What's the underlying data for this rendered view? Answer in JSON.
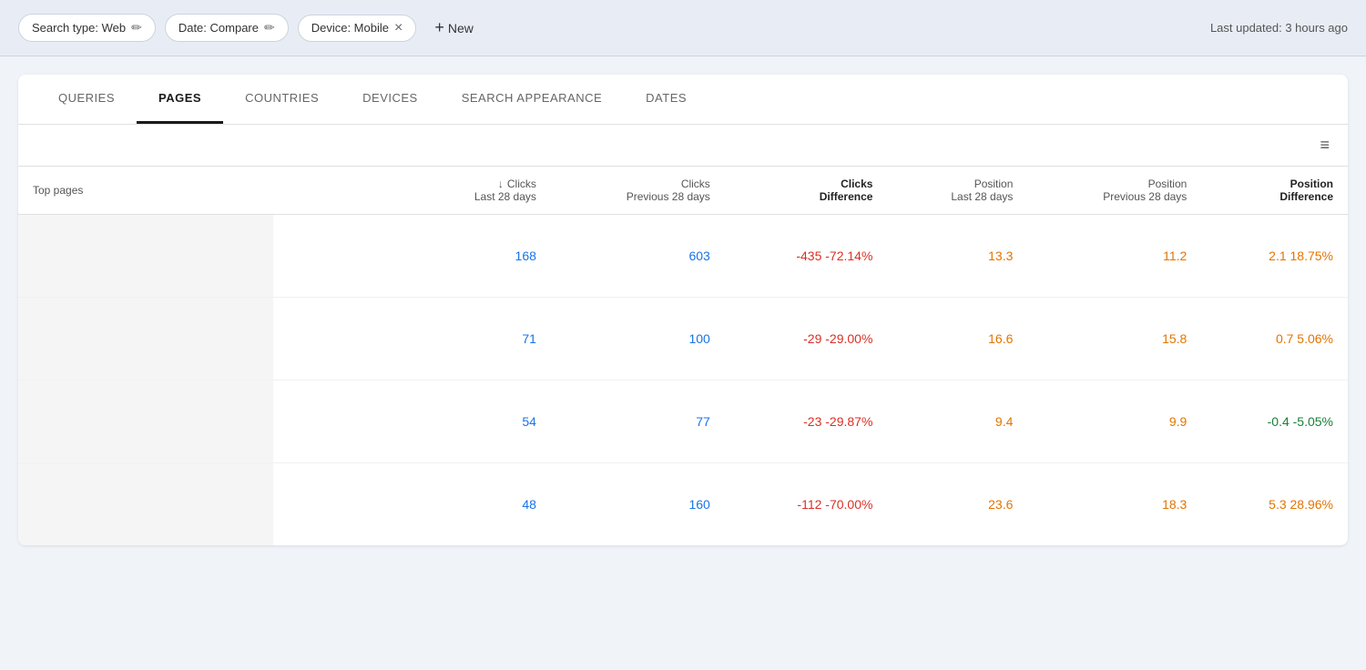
{
  "topbar": {
    "filters": [
      {
        "id": "search-type",
        "label": "Search type: Web",
        "hasEdit": true,
        "hasClose": false
      },
      {
        "id": "date",
        "label": "Date: Compare",
        "hasEdit": true,
        "hasClose": false
      },
      {
        "id": "device",
        "label": "Device: Mobile",
        "hasEdit": false,
        "hasClose": true
      }
    ],
    "new_button_label": "New",
    "last_updated": "Last updated: 3 hours ago"
  },
  "tabs": [
    {
      "id": "queries",
      "label": "QUERIES",
      "active": false
    },
    {
      "id": "pages",
      "label": "PAGES",
      "active": true
    },
    {
      "id": "countries",
      "label": "COUNTRIES",
      "active": false
    },
    {
      "id": "devices",
      "label": "DEVICES",
      "active": false
    },
    {
      "id": "search-appearance",
      "label": "SEARCH APPEARANCE",
      "active": false
    },
    {
      "id": "dates",
      "label": "DATES",
      "active": false
    }
  ],
  "table": {
    "columns": [
      {
        "id": "top-pages",
        "label": "Top pages",
        "sub": "",
        "bold": false,
        "sorted": false
      },
      {
        "id": "clicks-last",
        "label": "Clicks",
        "sub": "Last 28 days",
        "bold": false,
        "sorted": true
      },
      {
        "id": "clicks-prev",
        "label": "Clicks",
        "sub": "Previous 28 days",
        "bold": false,
        "sorted": false
      },
      {
        "id": "clicks-diff",
        "label": "Clicks",
        "sub": "Difference",
        "bold": true,
        "sorted": false
      },
      {
        "id": "position-last",
        "label": "Position",
        "sub": "Last 28 days",
        "bold": false,
        "sorted": false
      },
      {
        "id": "position-prev",
        "label": "Position",
        "sub": "Previous 28 days",
        "bold": false,
        "sorted": false
      },
      {
        "id": "position-diff",
        "label": "Position",
        "sub": "Difference",
        "bold": true,
        "sorted": false
      }
    ],
    "rows": [
      {
        "clicks_last": "168",
        "clicks_prev": "603",
        "clicks_diff": "-435 -72.14%",
        "clicks_diff_type": "red",
        "position_last": "13.3",
        "position_prev": "11.2",
        "position_diff": "2.1 18.75%",
        "position_diff_type": "orange"
      },
      {
        "clicks_last": "71",
        "clicks_prev": "100",
        "clicks_diff": "-29 -29.00%",
        "clicks_diff_type": "red",
        "position_last": "16.6",
        "position_prev": "15.8",
        "position_diff": "0.7 5.06%",
        "position_diff_type": "orange"
      },
      {
        "clicks_last": "54",
        "clicks_prev": "77",
        "clicks_diff": "-23 -29.87%",
        "clicks_diff_type": "red",
        "position_last": "9.4",
        "position_prev": "9.9",
        "position_diff": "-0.4 -5.05%",
        "position_diff_type": "green"
      },
      {
        "clicks_last": "48",
        "clicks_prev": "160",
        "clicks_diff": "-112 -70.00%",
        "clicks_diff_type": "red",
        "position_last": "23.6",
        "position_prev": "18.3",
        "position_diff": "5.3 28.96%",
        "position_diff_type": "orange"
      }
    ]
  }
}
